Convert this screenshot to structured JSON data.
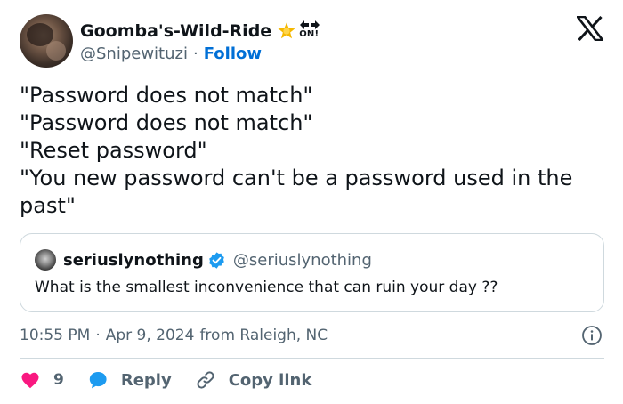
{
  "author": {
    "display_name": "Goomba's-Wild-Ride",
    "handle": "@Snipewituzi",
    "separator": "·",
    "follow_label": "Follow",
    "badge_text": "ON!"
  },
  "tweet": {
    "lines": [
      "\"Password does not match\"",
      "\"Password does not match\"",
      "\"Reset password\"",
      "\"You new password can't be a password used in the past\""
    ]
  },
  "quote": {
    "display_name": "seriuslynothing",
    "handle": "@seriuslynothing",
    "text": "What is the smallest inconvenience that can ruin your day ??"
  },
  "meta": {
    "time": "10:55 PM",
    "separator": "·",
    "date": "Apr 9, 2024",
    "location": "from Raleigh, NC"
  },
  "actions": {
    "like_count": "9",
    "reply_label": "Reply",
    "copy_label": "Copy link"
  },
  "colors": {
    "like": "#f91880",
    "reply": "#1d9bf0",
    "verified": "#1d9bf0",
    "follow": "#006fd6",
    "star": "#f5b800"
  },
  "icons": [
    "star-icon",
    "arrows-icon",
    "x-logo-icon",
    "verified-icon",
    "info-icon",
    "heart-icon",
    "reply-bubble-icon",
    "link-icon"
  ]
}
